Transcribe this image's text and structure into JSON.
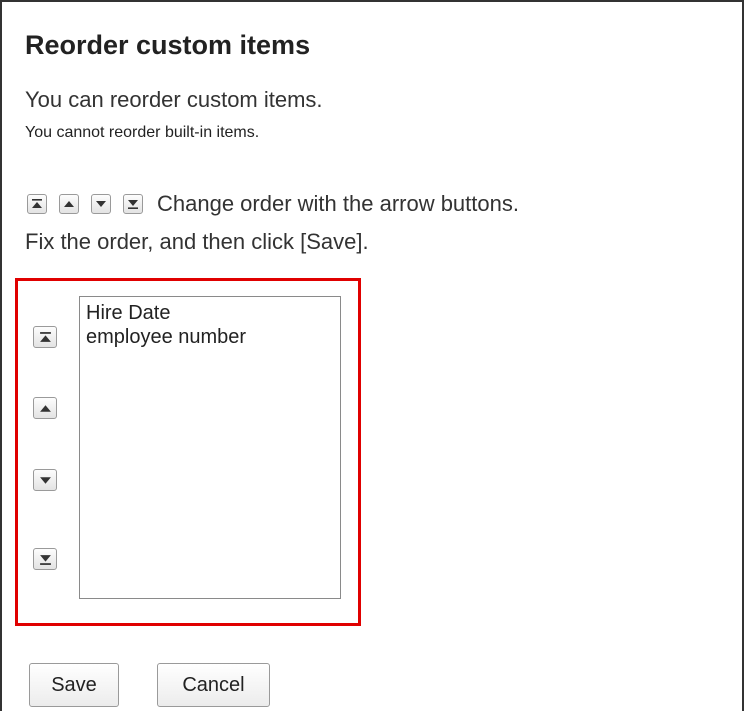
{
  "title": "Reorder custom items",
  "description": "You can reorder custom items.",
  "note": "You cannot reorder built-in items.",
  "instructions": {
    "line1": "Change order with the arrow buttons.",
    "line2": "Fix the order, and then click [Save]."
  },
  "icons": {
    "move_top": "move-to-top-icon",
    "move_up": "move-up-icon",
    "move_down": "move-down-icon",
    "move_bottom": "move-to-bottom-icon"
  },
  "list": {
    "items": [
      "Hire Date",
      "employee number"
    ]
  },
  "buttons": {
    "save": "Save",
    "cancel": "Cancel"
  },
  "colors": {
    "highlight": "#e00000",
    "button_border": "#9a9a9a"
  }
}
